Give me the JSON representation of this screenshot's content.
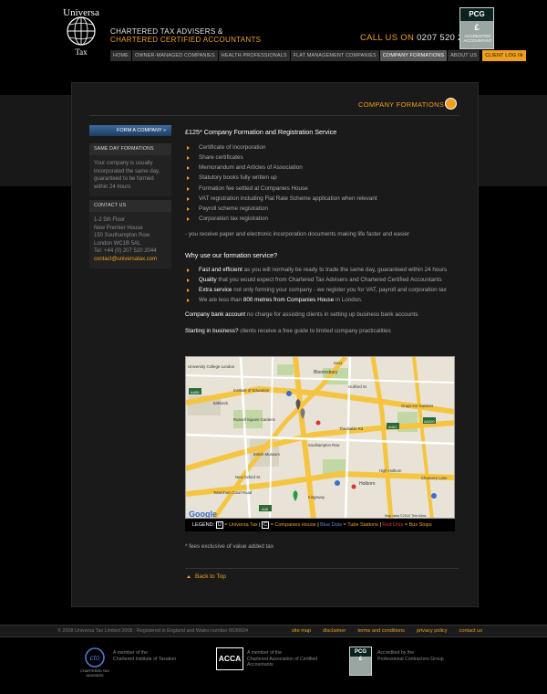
{
  "header": {
    "logo_text_top": "Universa",
    "logo_text_bottom": "Tax",
    "tagline_line1": "CHARTERED TAX ADVISERS &",
    "tagline_line2": "CHARTERED CERTIFIED ACCOUNTANTS",
    "callus_label": "CALL US ON",
    "callus_number": "0207 520 2044",
    "badge_top": "PCG",
    "badge_mid": "£",
    "badge_bottom": "ACCREDITED ACCOUNTANT"
  },
  "nav": {
    "items": [
      {
        "label": "HOME"
      },
      {
        "label": "OWNER-MANAGED COMPANIES"
      },
      {
        "label": "HEALTH PROFESSIONALS"
      },
      {
        "label": "FLAT MANAGEMENT COMPANIES"
      },
      {
        "label": "COMPANY FORMATIONS"
      },
      {
        "label": "ABOUT US"
      }
    ],
    "login_label": "CLIENT LOG IN"
  },
  "section_title": "COMPANY FORMATIONS",
  "sidebar": {
    "tab_label": "FORM A COMPANY »",
    "block1_head": "SAME DAY FORMATIONS",
    "block1_body": "Your company is usually incorporated the same day, guaranteed to be formed within 24 hours",
    "block2_head": "CONTACT US",
    "address_lines": [
      "1-2 5th Floor",
      "New Premier House",
      "150 Southampton Row",
      "London WC1B 5AL",
      "Tel: +44 (0) 207 520 2044"
    ],
    "email": "contact@universatax.com"
  },
  "content": {
    "heading": "£125* Company Formation and Registration Service",
    "bullets": [
      "Certificate of incorporation",
      "Share certificates",
      "Memorandum and Articles of Association",
      "Statutory books fully written up",
      "Formation fee settled at Companies House",
      "VAT registration including Flat Rate Scheme application when relevant",
      "Payroll scheme registration",
      "Corporation tax registration"
    ],
    "note": "- you receive paper and electronic incorporation documents making life faster and easier",
    "why_heading": "Why use our formation service?",
    "why_items": [
      {
        "bold": "Fast and efficient",
        "text": " as you will normally be ready to trade the same day, guaranteed within 24 hours"
      },
      {
        "bold": "Quality",
        "text": " that you would expect from Chartered Tax Advisers and Chartered Certified Accountants"
      },
      {
        "bold": "Extra service",
        "text": " not only forming your company - we register you for VAT, payroll and corporation tax"
      },
      {
        "pre": "We are less than ",
        "bold": "800 metres from Companies House",
        "text": " in London."
      }
    ],
    "bank_bold": "Company bank account",
    "bank_text": " no charge for assisting clients in setting up business bank accounts",
    "start_bold": "Starting in business?",
    "start_text": " clients receive a free guide to limited company practicalities",
    "fees_note": "* fees exclusive of value added tax",
    "back_to_top": "Back to Top"
  },
  "map": {
    "labels": [
      "University College London",
      "Bloomsbury",
      "Institute of Education",
      "Birkbeck",
      "Russell Square Gardens",
      "British Museum",
      "Holborn",
      "Chancery Lane",
      "High Holborn",
      "Grays Inn Gardens",
      "Tottenham Court Road",
      "New Oxford St",
      "Southampton Row",
      "Kingsway",
      "Theobalds Rd",
      "Guilford St",
      "A400",
      "A401",
      "A40",
      "A5200",
      "B504",
      "Map data ©2010 Tele Atlas"
    ],
    "google": "Google"
  },
  "legend": {
    "label": "LEGEND:",
    "u": "U",
    "u_text": "= Universa Tax",
    "c": "C",
    "c_text": "= Companies House",
    "blue": "Blue Dots",
    "tube": "= Tube Stations",
    "red": "Red Dots",
    "bus": "= Bus Stops"
  },
  "footer": {
    "copyright": "© 2008 Universa Tax Limited 2008 : Registered in England and Wales number 6630604",
    "links": [
      "site map",
      "disclaimer",
      "terms and conditions",
      "privacy policy",
      "contact us"
    ],
    "cto_caption": "CHARTERED TAX ADVISERS",
    "assoc1_line1": "A member of the",
    "assoc1_line2": "Chartered Institute of Taxation",
    "acca": "ACCA",
    "assoc2_line1": "A member of the",
    "assoc2_line2": "Chartered Association of Certified",
    "assoc2_line3": "Accountants",
    "pcg_top": "PCG",
    "pcg_mid": "£",
    "assoc3_line1": "Accredited by the",
    "assoc3_line2": "Professional Contractors Group"
  }
}
